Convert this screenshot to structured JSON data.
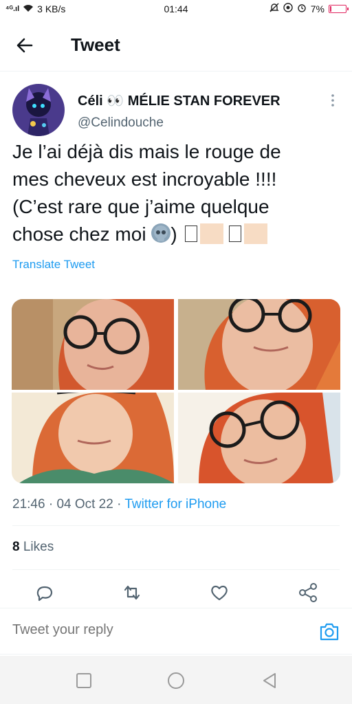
{
  "status_bar": {
    "signal": "⁴ᴳ.ıl",
    "speed": "3 KB/s",
    "time": "01:44",
    "battery": "7%",
    "battery_level": 0.07
  },
  "header": {
    "title": "Tweet"
  },
  "tweet": {
    "display_name": "Céli 👀 MÉLIE STAN FOREVER",
    "handle": "@Celindouche",
    "text_lines": [
      "Je l’ai déjà dis mais le rouge de",
      "mes cheveux est incroyable !!!!",
      "(C’est rare que j’aime quelque",
      "chose chez moi"
    ],
    "text_tail": ")",
    "translate_label": "Translate Tweet",
    "time": "21:46",
    "date": "04 Oct 22",
    "source": "Twitter for iPhone",
    "likes_count": "8",
    "likes_label": "Likes"
  },
  "reply": {
    "placeholder": "Tweet your reply"
  },
  "colors": {
    "accent": "#1d9bf0",
    "muted_text": "#536471",
    "battery_low": "#e0245e"
  }
}
